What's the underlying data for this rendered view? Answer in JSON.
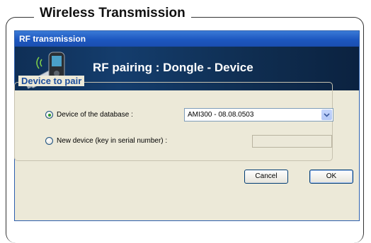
{
  "frame": {
    "title": "Wireless Transmission"
  },
  "window": {
    "title": "RF transmission"
  },
  "banner": {
    "title": "RF pairing : Dongle - Device"
  },
  "group": {
    "legend": "Device to pair",
    "options": [
      {
        "label": "Device of the database :",
        "checked": true
      },
      {
        "label": "New device (key in serial number) :",
        "checked": false
      }
    ],
    "selected_device": "AMI300 - 08.08.0503",
    "serial_value": ""
  },
  "buttons": {
    "cancel": "Cancel",
    "ok": "OK"
  },
  "colors": {
    "titlebar": "#1d57c0",
    "banner": "#143d6d",
    "legend": "#1c4d9c"
  },
  "icons": [
    "dongle-device-icon",
    "chevron-down-icon"
  ]
}
